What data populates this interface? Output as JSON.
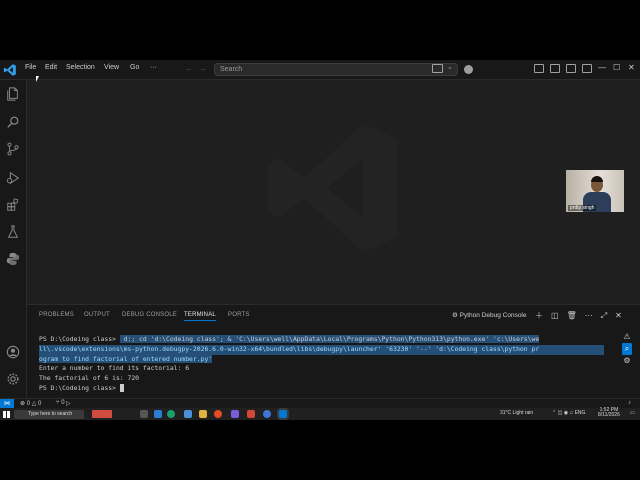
{
  "titlebar": {
    "menus": [
      "File",
      "Edit",
      "Selection",
      "View",
      "Go",
      "···"
    ],
    "search_placeholder": "Search",
    "window_controls": [
      "—",
      "☐",
      "✕"
    ]
  },
  "activity_icons": [
    "explorer-icon",
    "search-icon",
    "source-control-icon",
    "run-debug-icon",
    "extensions-icon",
    "testing-icon",
    "python-icon",
    "account-icon",
    "settings-icon"
  ],
  "webcam": {
    "name": "prdip singh"
  },
  "panel": {
    "tabs": [
      "PROBLEMS",
      "OUTPUT",
      "DEBUG CONSOLE",
      "TERMINAL",
      "PORTS"
    ],
    "active_tab": "TERMINAL",
    "debug_console_label": "Python Debug Console"
  },
  "terminal": {
    "prompt1": "PS D:\\Codeing class> ",
    "cmd1": " d:; cd 'd:\\Codeing class'; & 'C:\\Users\\well\\AppData\\Local\\Programs\\Python\\Python313\\python.exe' 'c:\\Users\\we",
    "cmd2": "ll\\.vscode\\extensions\\ms-python.debugpy-2026.6.0-win32-x64\\bundled\\libs\\debugpy\\launcher' '63230' '--' 'd:\\Codeing class\\python pr",
    "cmd3": "ogram to find factorial of entered number.py'",
    "out1": "Enter a number to find its factorial: 6",
    "out2": "The factorial of 6 is: 720",
    "prompt2": "PS D:\\Codeing class> "
  },
  "statusbar": {
    "errors": "⊗ 0 △ 0",
    "ports": "⑂ 0"
  },
  "taskbar": {
    "search_placeholder": "Type here to search",
    "weather": "31°C  Light rain",
    "time": "1:52 PM",
    "date": "8/11/2026"
  },
  "colors": {
    "accent": "#0078d4",
    "editor_bg": "#1f1f1f",
    "chrome_bg": "#181818",
    "selection": "#264f78"
  }
}
